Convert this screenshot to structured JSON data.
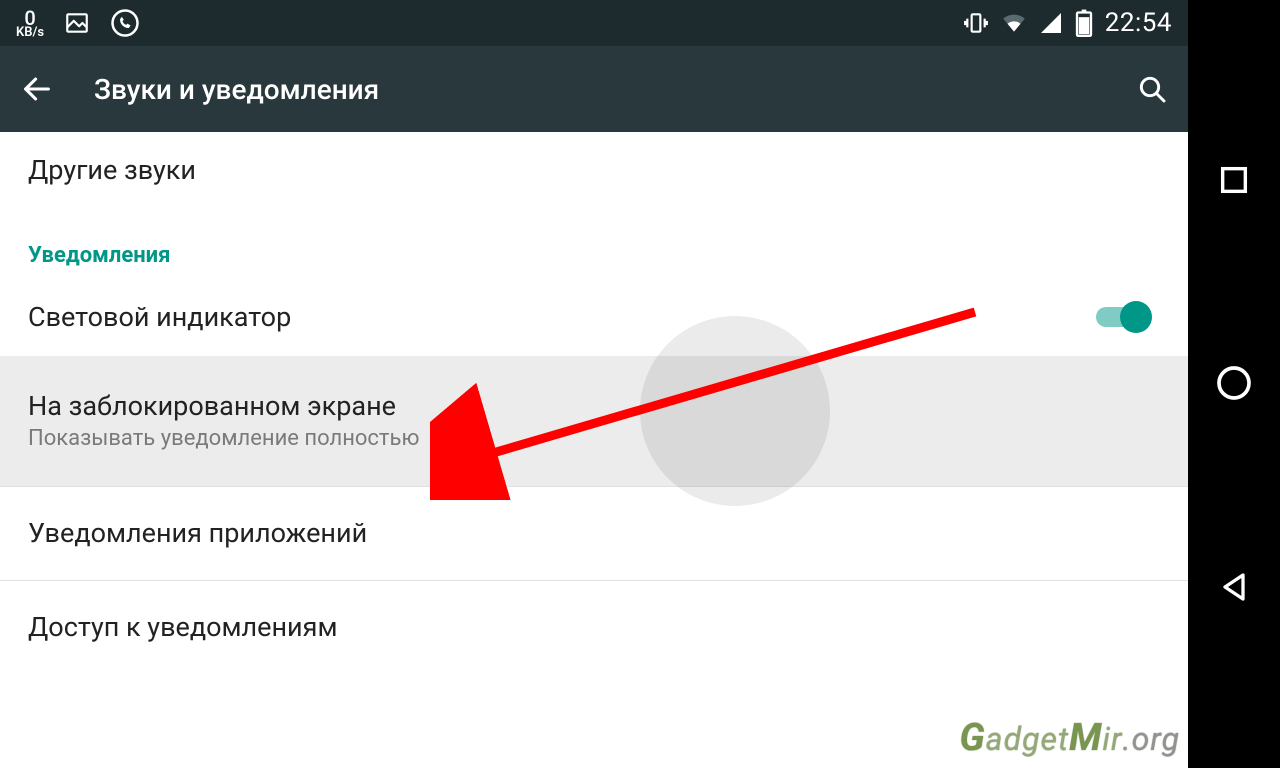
{
  "statusbar": {
    "kbs_value": "0",
    "kbs_unit": "KB/s",
    "time": "22:54"
  },
  "appbar": {
    "title": "Звуки и уведомления"
  },
  "list": {
    "other_sounds": "Другие звуки",
    "section_notifications": "Уведомления",
    "light_indicator": "Световой индикатор",
    "lock_screen_title": "На заблокированном экране",
    "lock_screen_sub": "Показывать уведомление полностью",
    "app_notifications": "Уведомления приложений",
    "notification_access": "Доступ к уведомлениям"
  },
  "switches": {
    "light_indicator_on": true
  },
  "watermark": {
    "g": "G",
    "rest": "adget",
    "m": "M",
    "ir": "ir",
    "dot": ".",
    "org": "org"
  },
  "colors": {
    "accent": "#009688",
    "statusbar": "#1e2b2e",
    "appbar": "#28383c",
    "annotation": "#ff0000"
  }
}
